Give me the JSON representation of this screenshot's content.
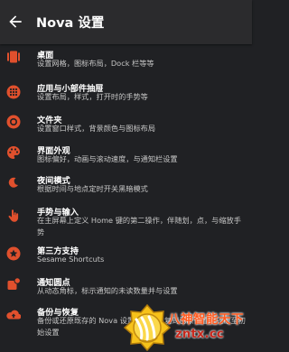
{
  "appbar": {
    "title": "Nova 设置"
  },
  "accent": "#e0502d",
  "items": [
    {
      "title": "桌面",
      "subtitle": "设置网格，图标布局，Dock 栏等等",
      "icon": "desktop-icon"
    },
    {
      "title": "应用与小部件抽屉",
      "subtitle": "设置布局，样式，打开时的手势等",
      "icon": "app-drawer-icon"
    },
    {
      "title": "文件夹",
      "subtitle": "设置窗口样式，背景颜色与图标布局",
      "icon": "folder-icon"
    },
    {
      "title": "界面外观",
      "subtitle": "图标偏好，动画与滚动速度，与通知栏设置",
      "icon": "palette-icon"
    },
    {
      "title": "夜间模式",
      "subtitle": "根据时间与地点定时开关黑暗模式",
      "icon": "moon-icon"
    },
    {
      "title": "手势与输入",
      "subtitle": "在主屏幕上定义 Home 键的第二操作，伴随划，点，与缩放手势",
      "icon": "gesture-icon"
    },
    {
      "title": "第三方支持",
      "subtitle": "Sesame Shortcuts",
      "icon": "third-party-icon"
    },
    {
      "title": "通知圆点",
      "subtitle": "从动态角标，标示通知的未读数量并与设置",
      "icon": "notification-dot-icon"
    },
    {
      "title": "备份与恢复",
      "subtitle": "备份或还原既存的 Nova 设置，以及恢复到已原设置，还原至初始设置",
      "icon": "backup-icon"
    }
  ],
  "watermark": {
    "top": "八神智能天下",
    "bottom": "zntx.cc"
  }
}
